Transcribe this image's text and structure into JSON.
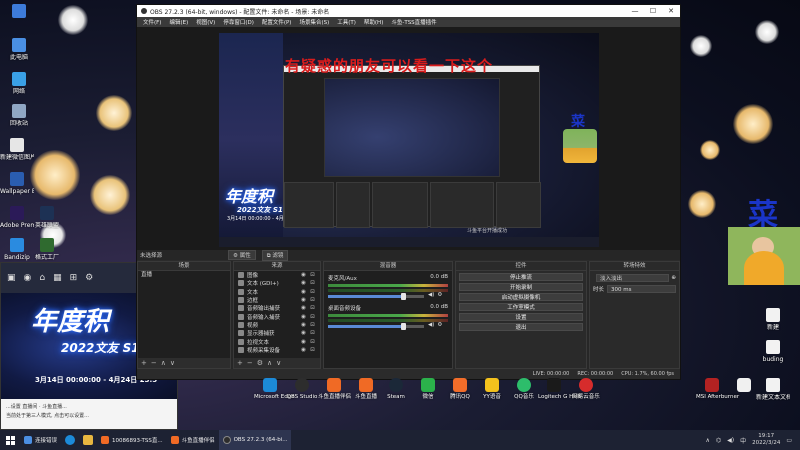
{
  "desktop": {
    "left_icons": [
      {
        "label": "",
        "color": "#3d7bd9"
      },
      {
        "label": "此电脑",
        "color": "#4a8fe3"
      },
      {
        "label": "网络",
        "color": "#3aa0e6"
      },
      {
        "label": "回收站",
        "color": "#8fa6c3"
      },
      {
        "label": "新建微信图片 文件",
        "color": "#e6e6e6"
      },
      {
        "label": "Wallpaper Engine:...",
        "color": "#2a5db0"
      },
      {
        "label": "Adobe Premie...",
        "color": "#2b1a58"
      },
      {
        "label": "英雄联盟",
        "color": "#1d3154"
      },
      {
        "label": "Bandizip",
        "color": "#2a8be0"
      },
      {
        "label": "格式工厂",
        "color": "#2f6a2f"
      }
    ],
    "right_icons": [
      {
        "label": "",
        "color": "#f2f2f2"
      },
      {
        "label": "新建",
        "color": "#f2f2f2"
      },
      {
        "label": "buding",
        "color": "#f2f2f2"
      },
      {
        "label": "新建文本文档",
        "color": "#f2f2f2"
      }
    ],
    "bottom_row_icons": [
      {
        "label": "Microsoft Edge",
        "color": "#1c8ad8"
      },
      {
        "label": "OBS Studio",
        "color": "#2d2d2d"
      },
      {
        "label": "斗鱼直播伴侣",
        "color": "#f06a25"
      },
      {
        "label": "斗鱼直播",
        "color": "#f06a25"
      },
      {
        "label": "Steam",
        "color": "#1b2838"
      },
      {
        "label": "微信",
        "color": "#2bb14b"
      },
      {
        "label": "腾讯QQ",
        "color": "#f26d2a"
      },
      {
        "label": "YY语音",
        "color": "#f4c21d"
      },
      {
        "label": "QQ音乐",
        "color": "#2dbd6b"
      },
      {
        "label": "Logitech G HUB",
        "color": "#1a1a1a"
      },
      {
        "label": "网易云音乐",
        "color": "#d62c2c"
      },
      {
        "label": "MSI Afterburner",
        "color": "#b32222"
      },
      {
        "label": "",
        "color": "#f0f0f0"
      }
    ]
  },
  "overlay": {
    "red_title": "有疑惑的朋友可以看一下这个",
    "year_banner": "年度积",
    "year_sub": "2022文友 S1",
    "date_range": "3月14日 00:00:00 - 4月24日 23:5",
    "cai": "菜",
    "toast": "斗鱼平台开播成功"
  },
  "obs": {
    "title": "OBS 27.2.3 (64-bit, windows) - 配置文件: 未命名 - 场景: 未命名",
    "menu": [
      "文件(F)",
      "编辑(E)",
      "视图(V)",
      "停靠窗口(D)",
      "配置文件(P)",
      "场景集合(S)",
      "工具(T)",
      "帮助(H)",
      "斗鱼-TSS直播插件"
    ],
    "window_controls": [
      "—",
      "☐",
      "✕"
    ],
    "source_toolbar": [
      "⚙ 属性",
      "⧉ 滤镜"
    ],
    "no_source": "未选择源",
    "docks": {
      "scenes": {
        "title": "场景",
        "items": [
          "直播"
        ],
        "footer": [
          "+",
          "−",
          "∧",
          "∨"
        ]
      },
      "sources": {
        "title": "来源",
        "items": [
          "图像",
          "文本 (GDI+)",
          "文本",
          "边框",
          "音频输出捕获",
          "音频输入捕获",
          "视频",
          "显示器捕获",
          "拉视文本",
          "视频采集设备"
        ],
        "footer": [
          "+",
          "−",
          "⚙",
          "∧",
          "∨"
        ]
      },
      "mixer": {
        "title": "混音器",
        "channels": [
          {
            "name": "麦克风/Aux",
            "db": "0.0 dB",
            "level": 0.78
          },
          {
            "name": "桌面音频设备",
            "db": "0.0 dB",
            "level": 0.78
          }
        ]
      },
      "transitions": {
        "title": "转场特效",
        "type_label": "",
        "type_value": "淡入淡出",
        "duration_label": "时长",
        "duration_value": "300 ms"
      },
      "controls": {
        "title": "控件",
        "buttons": [
          "停止推流",
          "开始录制",
          "启动虚拟摄像机",
          "工作室模式",
          "设置",
          "退出"
        ]
      }
    },
    "status": {
      "live": "LIVE: 00:00:00",
      "rec": "REC: 00:00:00",
      "cpu": "CPU: 1.7%, 60.00 fps",
      "fps": ""
    }
  },
  "leftwin": {
    "year_banner": "年度积",
    "year_sub": "2022文友 S1",
    "date_range": "3月14日 00:00:00 - 4月24日 23:5",
    "msg_lines": [
      "...设置 直播间 · 斗鱼直播...",
      "当前处于第三人模式, 点击可以设置..."
    ]
  },
  "taskbar": {
    "items": [
      {
        "label": "连接错误",
        "color": "#4b8fe3"
      },
      {
        "label": "",
        "color": "#1c8ad8"
      },
      {
        "label": "",
        "color": "#e6b640"
      },
      {
        "label": "10086893-TSS直...",
        "color": "#f06a25"
      },
      {
        "label": "斗鱼直播伴侣",
        "color": "#f06a25"
      },
      {
        "label": "OBS 27.2.3 (64-bi...",
        "color": "#2d2d2d"
      }
    ],
    "tray_time": "19:17",
    "tray_date": "2022/3/24",
    "tray_ime": "中"
  }
}
